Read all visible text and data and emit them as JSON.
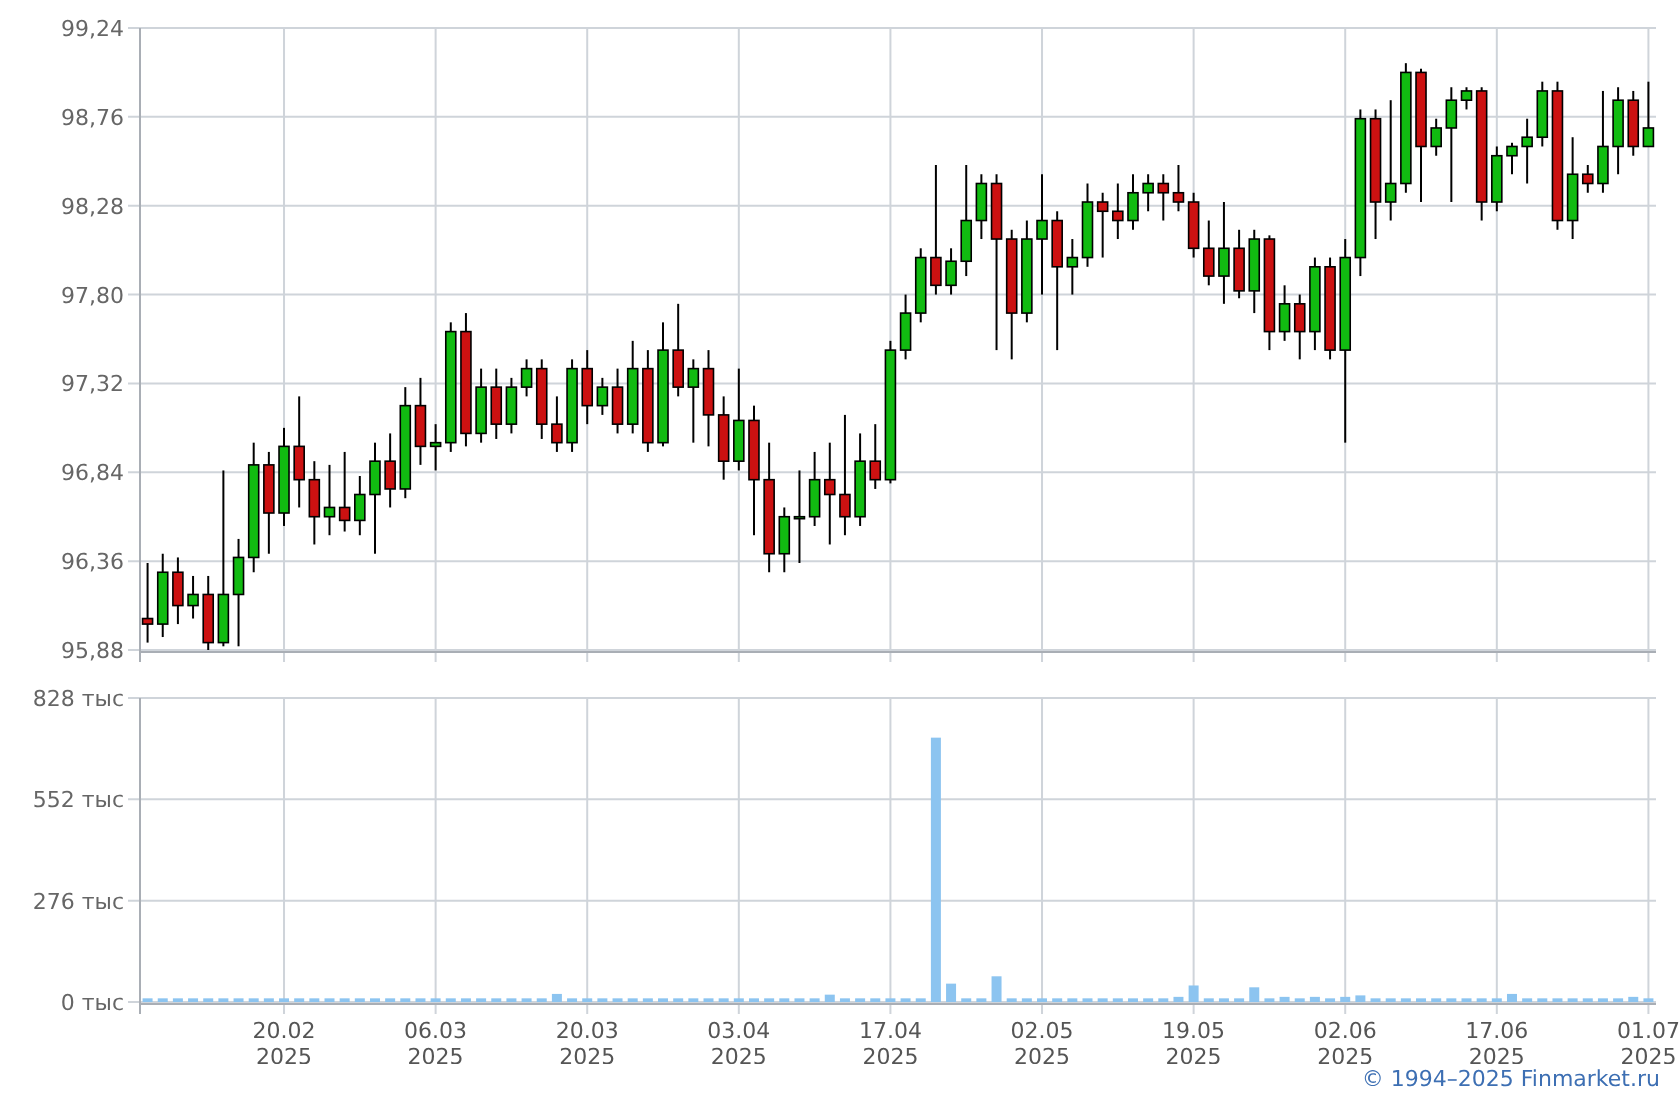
{
  "price_chart": {
    "chart_data": {
      "type": "candlestick",
      "ylim": [
        95.88,
        99.24
      ],
      "grid": true,
      "yticks": [
        {
          "value": 99.24,
          "label": "99,24"
        },
        {
          "value": 98.76,
          "label": "98,76"
        },
        {
          "value": 98.28,
          "label": "98,28"
        },
        {
          "value": 97.8,
          "label": "97,80"
        },
        {
          "value": 97.32,
          "label": "97,32"
        },
        {
          "value": 96.84,
          "label": "96,84"
        },
        {
          "value": 96.36,
          "label": "96,36"
        },
        {
          "value": 95.88,
          "label": "95,88"
        }
      ],
      "categories": [
        null,
        null,
        null,
        null,
        null,
        null,
        null,
        null,
        null,
        null,
        null,
        null,
        null,
        null,
        null,
        null,
        null,
        null,
        null,
        null,
        null,
        null,
        null,
        null,
        null,
        null,
        null,
        null,
        null,
        null,
        null,
        null,
        null,
        null,
        null,
        null,
        null,
        null,
        null,
        null,
        null,
        null,
        null,
        null,
        null,
        null,
        null,
        null,
        null,
        null,
        null,
        null,
        null,
        null,
        null,
        null,
        null,
        null,
        null,
        null,
        null,
        null,
        null,
        null,
        null,
        null,
        null,
        null,
        null,
        null,
        null,
        null,
        null,
        null,
        null,
        null,
        null,
        null,
        null,
        null,
        null,
        null,
        null,
        null,
        null,
        null,
        null,
        null,
        null,
        null,
        null,
        null,
        null,
        null,
        null,
        null,
        null,
        null,
        null,
        null
      ],
      "ohlc": [
        [
          96.05,
          96.35,
          95.92,
          96.02
        ],
        [
          96.02,
          96.4,
          95.95,
          96.3
        ],
        [
          96.3,
          96.38,
          96.02,
          96.12
        ],
        [
          96.12,
          96.28,
          96.05,
          96.18
        ],
        [
          96.18,
          96.28,
          95.88,
          95.92
        ],
        [
          95.92,
          96.85,
          95.9,
          96.18
        ],
        [
          96.18,
          96.48,
          95.9,
          96.38
        ],
        [
          96.38,
          97.0,
          96.3,
          96.88
        ],
        [
          96.88,
          96.95,
          96.4,
          96.62
        ],
        [
          96.62,
          97.08,
          96.55,
          96.98
        ],
        [
          96.98,
          97.25,
          96.65,
          96.8
        ],
        [
          96.8,
          96.9,
          96.45,
          96.6
        ],
        [
          96.6,
          96.88,
          96.5,
          96.65
        ],
        [
          96.65,
          96.95,
          96.52,
          96.58
        ],
        [
          96.58,
          96.82,
          96.5,
          96.72
        ],
        [
          96.72,
          97.0,
          96.4,
          96.9
        ],
        [
          96.9,
          97.05,
          96.65,
          96.75
        ],
        [
          96.75,
          97.3,
          96.7,
          97.2
        ],
        [
          97.2,
          97.35,
          96.88,
          96.98
        ],
        [
          96.98,
          97.1,
          96.85,
          97.0
        ],
        [
          97.0,
          97.65,
          96.95,
          97.6
        ],
        [
          97.6,
          97.7,
          96.98,
          97.05
        ],
        [
          97.05,
          97.4,
          97.0,
          97.3
        ],
        [
          97.3,
          97.4,
          97.02,
          97.1
        ],
        [
          97.1,
          97.35,
          97.05,
          97.3
        ],
        [
          97.3,
          97.45,
          97.25,
          97.4
        ],
        [
          97.4,
          97.45,
          97.02,
          97.1
        ],
        [
          97.1,
          97.25,
          96.95,
          97.0
        ],
        [
          97.0,
          97.45,
          96.95,
          97.4
        ],
        [
          97.4,
          97.5,
          97.1,
          97.2
        ],
        [
          97.2,
          97.35,
          97.15,
          97.3
        ],
        [
          97.3,
          97.4,
          97.05,
          97.1
        ],
        [
          97.1,
          97.55,
          97.05,
          97.4
        ],
        [
          97.4,
          97.5,
          96.95,
          97.0
        ],
        [
          97.0,
          97.65,
          96.98,
          97.5
        ],
        [
          97.5,
          97.75,
          97.25,
          97.3
        ],
        [
          97.3,
          97.45,
          97.0,
          97.4
        ],
        [
          97.4,
          97.5,
          96.98,
          97.15
        ],
        [
          97.15,
          97.25,
          96.8,
          96.9
        ],
        [
          96.9,
          97.4,
          96.85,
          97.12
        ],
        [
          97.12,
          97.2,
          96.5,
          96.8
        ],
        [
          96.8,
          97.0,
          96.3,
          96.4
        ],
        [
          96.4,
          96.65,
          96.3,
          96.6
        ],
        [
          96.6,
          96.85,
          96.35,
          96.6
        ],
        [
          96.6,
          96.95,
          96.55,
          96.8
        ],
        [
          96.8,
          97.0,
          96.45,
          96.72
        ],
        [
          96.72,
          97.15,
          96.5,
          96.6
        ],
        [
          96.6,
          97.05,
          96.55,
          96.9
        ],
        [
          96.9,
          97.1,
          96.75,
          96.8
        ],
        [
          96.8,
          97.55,
          96.78,
          97.5
        ],
        [
          97.5,
          97.8,
          97.45,
          97.7
        ],
        [
          97.7,
          98.05,
          97.65,
          98.0
        ],
        [
          98.0,
          98.5,
          97.8,
          97.85
        ],
        [
          97.85,
          98.05,
          97.8,
          97.98
        ],
        [
          97.98,
          98.5,
          97.9,
          98.2
        ],
        [
          98.2,
          98.45,
          98.1,
          98.4
        ],
        [
          98.4,
          98.45,
          97.5,
          98.1
        ],
        [
          98.1,
          98.15,
          97.45,
          97.7
        ],
        [
          97.7,
          98.2,
          97.65,
          98.1
        ],
        [
          98.1,
          98.45,
          97.8,
          98.2
        ],
        [
          98.2,
          98.25,
          97.5,
          97.95
        ],
        [
          97.95,
          98.1,
          97.8,
          98.0
        ],
        [
          98.0,
          98.4,
          97.95,
          98.3
        ],
        [
          98.3,
          98.35,
          98.0,
          98.25
        ],
        [
          98.25,
          98.4,
          98.1,
          98.2
        ],
        [
          98.2,
          98.45,
          98.15,
          98.35
        ],
        [
          98.35,
          98.45,
          98.25,
          98.4
        ],
        [
          98.4,
          98.45,
          98.2,
          98.35
        ],
        [
          98.35,
          98.5,
          98.25,
          98.3
        ],
        [
          98.3,
          98.35,
          98.0,
          98.05
        ],
        [
          98.05,
          98.2,
          97.85,
          97.9
        ],
        [
          97.9,
          98.3,
          97.75,
          98.05
        ],
        [
          98.05,
          98.15,
          97.78,
          97.82
        ],
        [
          97.82,
          98.15,
          97.7,
          98.1
        ],
        [
          98.1,
          98.12,
          97.5,
          97.6
        ],
        [
          97.6,
          97.85,
          97.55,
          97.75
        ],
        [
          97.75,
          97.8,
          97.45,
          97.6
        ],
        [
          97.6,
          98.0,
          97.5,
          97.95
        ],
        [
          97.95,
          98.0,
          97.45,
          97.5
        ],
        [
          97.5,
          98.1,
          97.0,
          98.0
        ],
        [
          98.0,
          98.8,
          97.9,
          98.75
        ],
        [
          98.75,
          98.8,
          98.1,
          98.3
        ],
        [
          98.3,
          98.85,
          98.2,
          98.4
        ],
        [
          98.4,
          99.05,
          98.35,
          99.0
        ],
        [
          99.0,
          99.02,
          98.3,
          98.6
        ],
        [
          98.6,
          98.75,
          98.55,
          98.7
        ],
        [
          98.7,
          98.92,
          98.3,
          98.85
        ],
        [
          98.85,
          98.92,
          98.8,
          98.9
        ],
        [
          98.9,
          98.92,
          98.2,
          98.3
        ],
        [
          98.3,
          98.6,
          98.25,
          98.55
        ],
        [
          98.55,
          98.62,
          98.45,
          98.6
        ],
        [
          98.6,
          98.75,
          98.4,
          98.65
        ],
        [
          98.65,
          98.95,
          98.6,
          98.9
        ],
        [
          98.9,
          98.95,
          98.15,
          98.2
        ],
        [
          98.2,
          98.65,
          98.1,
          98.45
        ],
        [
          98.45,
          98.5,
          98.35,
          98.4
        ],
        [
          98.4,
          98.9,
          98.35,
          98.6
        ],
        [
          98.6,
          98.92,
          98.45,
          98.85
        ],
        [
          98.85,
          98.9,
          98.55,
          98.6
        ],
        [
          98.6,
          98.95,
          98.6,
          98.7
        ]
      ]
    }
  },
  "volume_chart": {
    "chart_data": {
      "type": "bar",
      "ylim": [
        0,
        828
      ],
      "grid": true,
      "yticks": [
        {
          "value": 828,
          "label": "828 тыс"
        },
        {
          "value": 552,
          "label": "552 тыс"
        },
        {
          "value": 276,
          "label": "276 тыс"
        },
        {
          "value": 0,
          "label": "0 тыс"
        }
      ],
      "series": [
        {
          "color": "#8cc4f0",
          "values": [
            10,
            10,
            10,
            10,
            10,
            10,
            10,
            10,
            10,
            10,
            10,
            10,
            10,
            10,
            10,
            10,
            10,
            10,
            10,
            10,
            10,
            10,
            10,
            10,
            10,
            10,
            10,
            22,
            10,
            10,
            10,
            10,
            10,
            10,
            10,
            10,
            10,
            10,
            10,
            10,
            10,
            10,
            10,
            10,
            10,
            20,
            10,
            10,
            10,
            10,
            10,
            10,
            720,
            50,
            10,
            10,
            70,
            10,
            10,
            10,
            10,
            10,
            10,
            10,
            10,
            10,
            10,
            10,
            14,
            45,
            10,
            10,
            10,
            40,
            10,
            14,
            10,
            14,
            10,
            14,
            18,
            10,
            10,
            10,
            10,
            10,
            10,
            10,
            10,
            10,
            22,
            10,
            10,
            10,
            10,
            10,
            10,
            10,
            14,
            10
          ]
        }
      ]
    },
    "x_axis_labels": [
      {
        "date": "20.02",
        "year": "2025"
      },
      {
        "date": "06.03",
        "year": "2025"
      },
      {
        "date": "20.03",
        "year": "2025"
      },
      {
        "date": "03.04",
        "year": "2025"
      },
      {
        "date": "17.04",
        "year": "2025"
      },
      {
        "date": "02.05",
        "year": "2025"
      },
      {
        "date": "19.05",
        "year": "2025"
      },
      {
        "date": "02.06",
        "year": "2025"
      },
      {
        "date": "17.06",
        "year": "2025"
      },
      {
        "date": "01.07",
        "year": "2025"
      }
    ]
  },
  "footer": {
    "copyright": "© 1994–2025 Finmarket.ru"
  }
}
